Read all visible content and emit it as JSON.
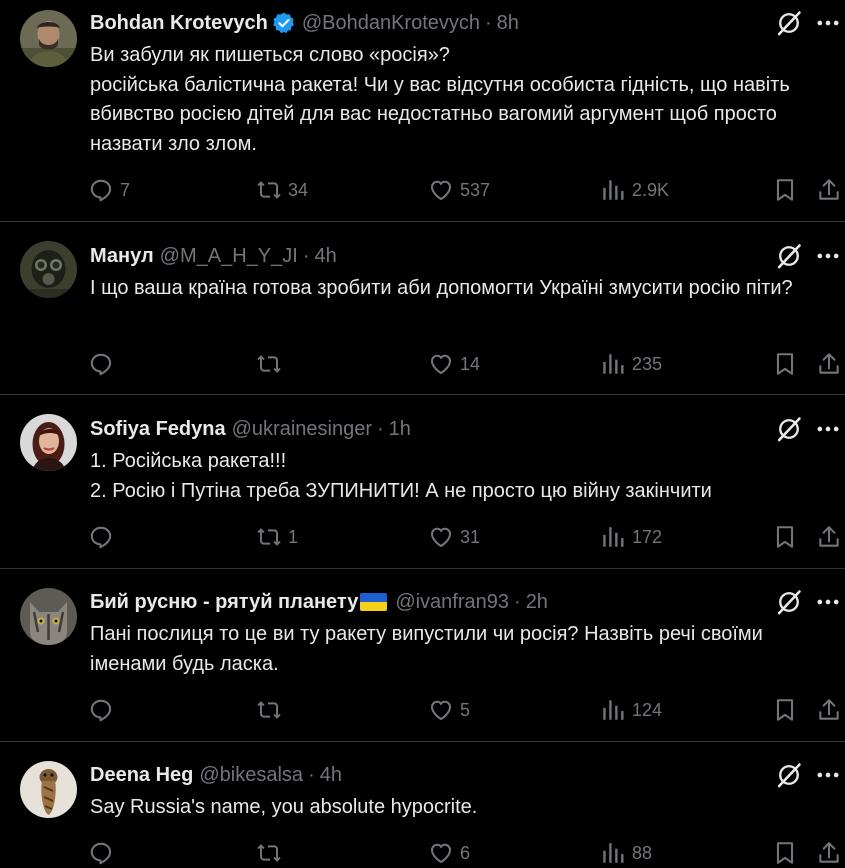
{
  "tweets": [
    {
      "name": "Bohdan Krotevych",
      "verified": true,
      "flag": false,
      "handle": "@BohdanKrotevych",
      "time": "8h",
      "lines": [
        "Ви забули як пишеться слово «росія»?",
        "російська балістична ракета! Чи у вас відсутня особиста  гідність, що навіть вбивство  росією дітей для вас недостатньо вагомий аргумент щоб  просто назвати зло злом."
      ],
      "replies": "7",
      "retweets": "34",
      "likes": "537",
      "views": "2.9K"
    },
    {
      "name": "Манул",
      "verified": false,
      "flag": false,
      "handle": "@M_A_H_Y_JI",
      "time": "4h",
      "lines": [
        "І що ваша країна готова зробити аби допомогти Україні змусити росію піти?"
      ],
      "replies": "",
      "retweets": "",
      "likes": "14",
      "views": "235"
    },
    {
      "name": "Sofiya Fedyna",
      "verified": false,
      "flag": false,
      "handle": "@ukrainesinger",
      "time": "1h",
      "lines": [
        "1. Російська ракета!!!",
        "2. Росію і Путіна треба ЗУПИНИТИ! А не просто цю війну закінчити"
      ],
      "replies": "",
      "retweets": "1",
      "likes": "31",
      "views": "172"
    },
    {
      "name": "Бий русню - рятуй планету",
      "verified": false,
      "flag": true,
      "handle": "@ivanfran93",
      "time": "2h",
      "lines": [
        "Пані послиця то це ви ту ракету випустили чи росія? Назвіть речі своїми іменами будь ласка."
      ],
      "replies": "",
      "retweets": "",
      "likes": "5",
      "views": "124"
    },
    {
      "name": "Deena Heg",
      "verified": false,
      "flag": false,
      "handle": "@bikesalsa",
      "time": "4h",
      "lines": [
        "Say Russia's name, you absolute hypocrite."
      ],
      "replies": "",
      "retweets": "",
      "likes": "6",
      "views": "88"
    }
  ],
  "colors": {
    "background": "#000000",
    "text": "#e7e9ea",
    "muted": "#71767b",
    "divider": "#2f3336",
    "verified": "#1d9bf0"
  },
  "icons": [
    "reply-icon",
    "retweet-icon",
    "like-icon",
    "views-icon",
    "bookmark-icon",
    "share-icon",
    "grok-icon",
    "more-icon",
    "verified-icon"
  ]
}
